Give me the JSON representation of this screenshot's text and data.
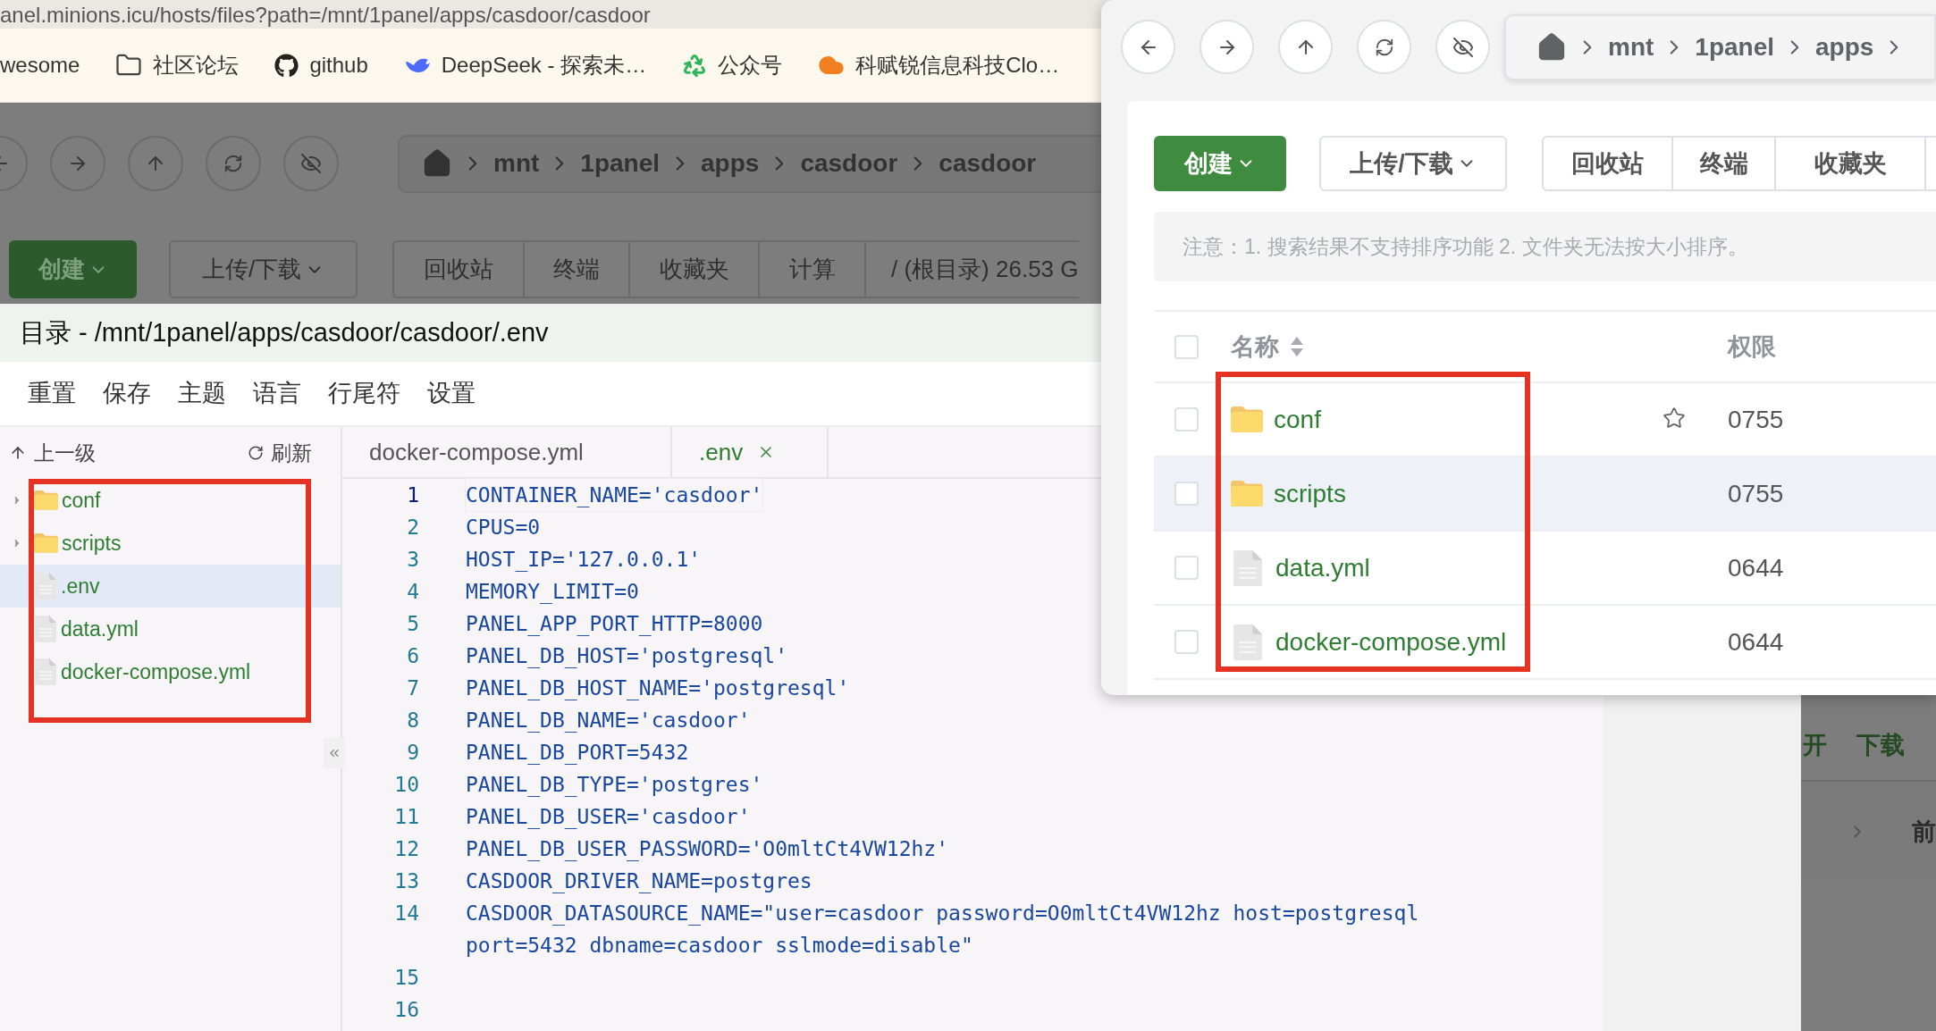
{
  "address_bar": {
    "url": "anel.minions.icu/hosts/files?path=/mnt/1panel/apps/casdoor/casdoor"
  },
  "bookmarks": [
    {
      "label": "wesome"
    },
    {
      "label": "社区论坛",
      "kind": "folder"
    },
    {
      "label": "github",
      "kind": "github"
    },
    {
      "label": "DeepSeek - 探索未…",
      "kind": "whale"
    },
    {
      "label": "公众号",
      "kind": "recycle"
    },
    {
      "label": "科赋锐信息科技Clo…",
      "kind": "cloud"
    }
  ],
  "file_manager": {
    "breadcrumb": [
      "mnt",
      "1panel",
      "apps",
      "casdoor",
      "casdoor"
    ],
    "create": "创建",
    "transfer": "上传/下载",
    "group": [
      "回收站",
      "终端",
      "收藏夹",
      "计算",
      "/ (根目录) 26.53 G"
    ]
  },
  "editor": {
    "title": "目录 - /mnt/1panel/apps/casdoor/casdoor/.env",
    "menu": [
      "重置",
      "保存",
      "主题",
      "语言",
      "行尾符",
      "设置"
    ],
    "tree_up": "上一级",
    "tree_refresh": "刷新",
    "tree": [
      {
        "name": "conf",
        "kind": "folder",
        "expanded": false,
        "selected": false
      },
      {
        "name": "scripts",
        "kind": "folder",
        "expanded": false,
        "selected": false
      },
      {
        "name": ".env",
        "kind": "file",
        "selected": true
      },
      {
        "name": "data.yml",
        "kind": "file",
        "selected": false
      },
      {
        "name": "docker-compose.yml",
        "kind": "file",
        "selected": false
      }
    ],
    "tabs": [
      {
        "label": "docker-compose.yml",
        "selected": false
      },
      {
        "label": ".env",
        "selected": true
      }
    ],
    "lines": [
      {
        "number": "1",
        "text": "CONTAINER_NAME='casdoor'",
        "current": true
      },
      {
        "number": "2",
        "text": "CPUS=0",
        "current": false
      },
      {
        "number": "3",
        "text": "HOST_IP='127.0.0.1'",
        "current": false
      },
      {
        "number": "4",
        "text": "MEMORY_LIMIT=0",
        "current": false
      },
      {
        "number": "5",
        "text": "PANEL_APP_PORT_HTTP=8000",
        "current": false
      },
      {
        "number": "6",
        "text": "PANEL_DB_HOST='postgresql'",
        "current": false
      },
      {
        "number": "7",
        "text": "PANEL_DB_HOST_NAME='postgresql'",
        "current": false
      },
      {
        "number": "8",
        "text": "PANEL_DB_NAME='casdoor'",
        "current": false
      },
      {
        "number": "9",
        "text": "PANEL_DB_PORT=5432",
        "current": false
      },
      {
        "number": "10",
        "text": "PANEL_DB_TYPE='postgres'",
        "current": false
      },
      {
        "number": "11",
        "text": "PANEL_DB_USER='casdoor'",
        "current": false
      },
      {
        "number": "12",
        "text": "PANEL_DB_USER_PASSWORD='O0mltCt4VW12hz'",
        "current": false
      },
      {
        "number": "13",
        "text": "CASDOOR_DRIVER_NAME=postgres",
        "current": false
      },
      {
        "number": "14",
        "text": "CASDOOR_DATASOURCE_NAME=\"user=casdoor password=O0mltCt4VW12hz host=postgresql port=5432 dbname=casdoor sslmode=disable\"",
        "current": false
      },
      {
        "number": "15",
        "current": false
      },
      {
        "number": "16",
        "current": false
      }
    ]
  },
  "background_table": {
    "row_actions": [
      "开",
      "下载"
    ],
    "next_cell": "前"
  },
  "overlay_window": {
    "breadcrumb": [
      "mnt",
      "1panel",
      "apps"
    ],
    "create": "创建",
    "transfer": "上传/下载",
    "group": [
      "回收站",
      "终端",
      "收藏夹"
    ],
    "notice": "注意：1. 搜索结果不支持排序功能 2. 文件夹无法按大小排序。",
    "columns": [
      "名称",
      "权限"
    ],
    "header_checked": false,
    "rows": [
      {
        "name": "conf",
        "kind": "folder",
        "permission": "0755",
        "checked": false,
        "starred": true,
        "highlighted": false
      },
      {
        "name": "scripts",
        "kind": "folder",
        "permission": "0755",
        "checked": false,
        "starred": false,
        "highlighted": true
      },
      {
        "name": "data.yml",
        "kind": "file",
        "permission": "0644",
        "checked": false,
        "starred": false,
        "highlighted": false
      },
      {
        "name": "docker-compose.yml",
        "kind": "file",
        "permission": "0644",
        "checked": false,
        "starred": false,
        "highlighted": false
      }
    ]
  }
}
